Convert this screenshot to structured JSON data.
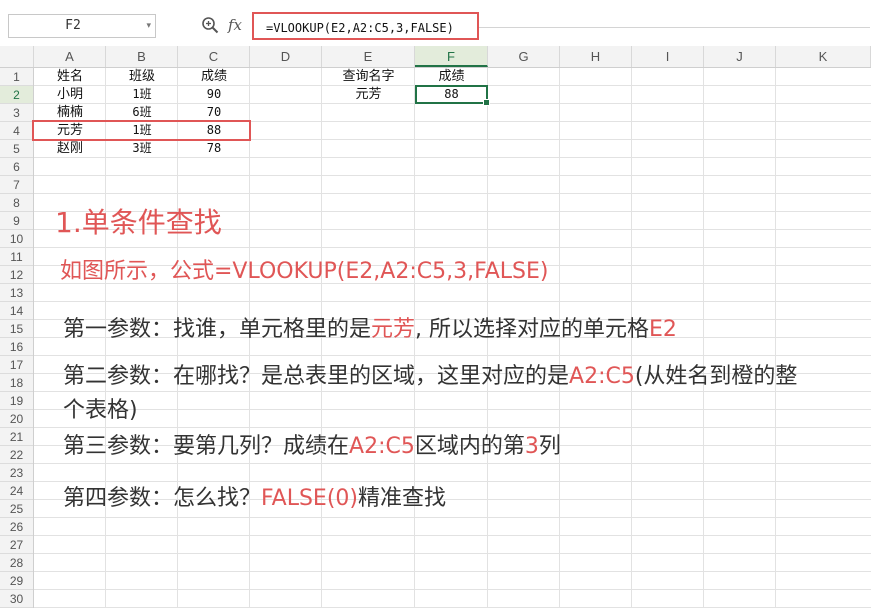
{
  "name_box": {
    "value": "F2"
  },
  "formula": {
    "fx_label": "fx",
    "text": "=VLOOKUP(E2,A2:C5,3,FALSE)"
  },
  "columns": [
    "A",
    "B",
    "C",
    "D",
    "E",
    "F",
    "G",
    "H",
    "I",
    "J",
    "K"
  ],
  "rows": [
    "1",
    "2",
    "3",
    "4",
    "5",
    "6",
    "7",
    "8",
    "9",
    "10",
    "11",
    "12",
    "13",
    "14",
    "15",
    "16",
    "17",
    "18",
    "19",
    "20",
    "21",
    "22",
    "23",
    "24",
    "25",
    "26",
    "27",
    "28",
    "29",
    "30"
  ],
  "table": {
    "headers": [
      "姓名",
      "班级",
      "成绩"
    ],
    "rows": [
      [
        "小明",
        "1班",
        "90"
      ],
      [
        "楠楠",
        "6班",
        "70"
      ],
      [
        "元芳",
        "1班",
        "88"
      ],
      [
        "赵刚",
        "3班",
        "78"
      ]
    ]
  },
  "lookup": {
    "label_header": "查询名字",
    "result_header": "成绩",
    "name": "元芳",
    "result": "88"
  },
  "content": {
    "title": "1.单条件查找",
    "subtitle": "如图所示，公式=VLOOKUP(E2,A2:C5,3,FALSE)",
    "p1_a": "第一参数：找谁，单元格里的是",
    "p1_b": "元芳",
    "p1_c": ", 所以选择对应的单元格",
    "p1_d": "E2",
    "p2_a": "第二参数：在哪找？是总表里的区域，这里对应的是",
    "p2_b": "A2:C5",
    "p2_c": "(从姓名到橙的整",
    "p2_d": "个表格)",
    "p3_a": "第三参数：要第几列？成绩在",
    "p3_b": "A2:C5",
    "p3_c": "区域内的第",
    "p3_d": "3",
    "p3_e": "列",
    "p4_a": "第四参数：怎么找？",
    "p4_b": "FALSE(0)",
    "p4_c": "精准查找"
  },
  "colors": {
    "accent_red": "#e05656",
    "selection_green": "#217346"
  }
}
